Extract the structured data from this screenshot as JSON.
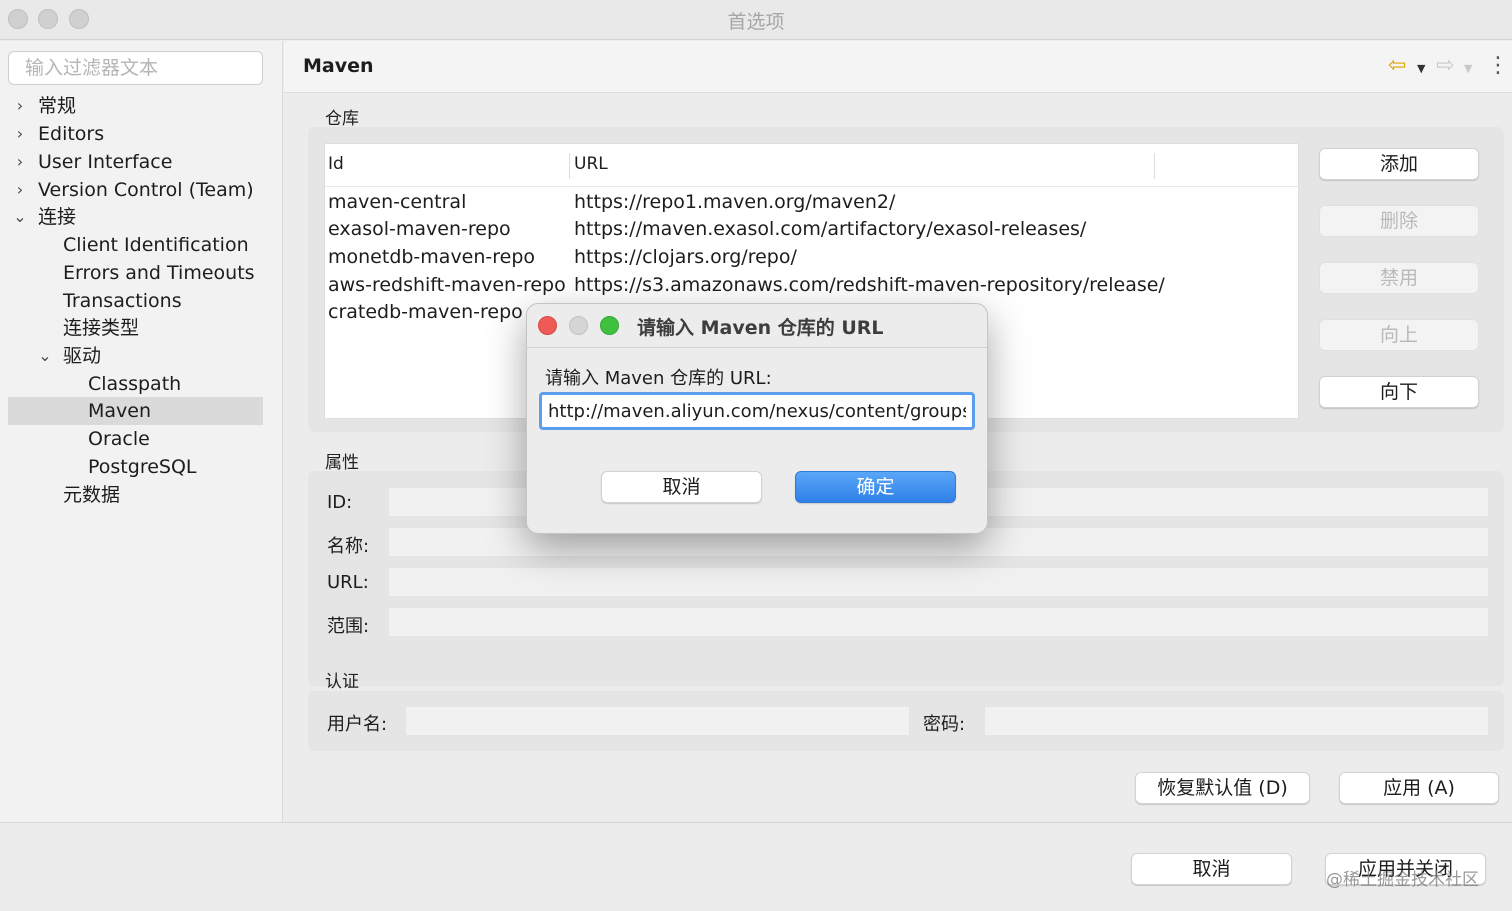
{
  "window": {
    "title": "首选项"
  },
  "sidebar": {
    "filter_placeholder": "输入过滤器文本",
    "items": [
      {
        "label": "常规"
      },
      {
        "label": "Editors"
      },
      {
        "label": "User Interface"
      },
      {
        "label": "Version Control (Team)"
      },
      {
        "label": "连接"
      },
      {
        "label": "Client Identification"
      },
      {
        "label": "Errors and Timeouts"
      },
      {
        "label": "Transactions"
      },
      {
        "label": "连接类型"
      },
      {
        "label": "驱动"
      },
      {
        "label": "Classpath"
      },
      {
        "label": "Maven"
      },
      {
        "label": "Oracle"
      },
      {
        "label": "PostgreSQL"
      },
      {
        "label": "元数据"
      }
    ]
  },
  "main": {
    "title": "Maven",
    "repo_section": {
      "label": "仓库",
      "columns": [
        "Id",
        "URL"
      ],
      "rows": [
        {
          "id": "maven-central",
          "url": "https://repo1.maven.org/maven2/"
        },
        {
          "id": "exasol-maven-repo",
          "url": "https://maven.exasol.com/artifactory/exasol-releases/"
        },
        {
          "id": "monetdb-maven-repo",
          "url": "https://clojars.org/repo/"
        },
        {
          "id": "aws-redshift-maven-repo",
          "url": "https://s3.amazonaws.com/redshift-maven-repository/release/"
        },
        {
          "id": "cratedb-maven-repo",
          "url": ""
        }
      ],
      "buttons": {
        "add": "添加",
        "delete": "删除",
        "disable": "禁用",
        "up": "向上",
        "down": "向下"
      }
    },
    "props_section": {
      "label": "属性",
      "fields": {
        "id": "ID:",
        "name": "名称:",
        "url": "URL:",
        "scope": "范围:"
      }
    },
    "auth_section": {
      "label": "认证",
      "username": "用户名:",
      "password": "密码:"
    },
    "restore_defaults": "恢复默认值 (D)",
    "apply": "应用 (A)"
  },
  "footer": {
    "cancel": "取消",
    "apply_close": "应用并关闭",
    "watermark": "@稀土掘金技术社区"
  },
  "dialog": {
    "title": "请输入 Maven 仓库的 URL",
    "prompt": "请输入 Maven 仓库的 URL:",
    "input_value": "http://maven.aliyun.com/nexus/content/groups/public/",
    "cancel": "取消",
    "ok": "确定"
  },
  "colors": {
    "accent": "#2f7fe8",
    "focus_ring": "#5d9ded",
    "close_light": "#ee5b57",
    "minimize_light": "#d6d6d6",
    "zoom_light": "#3fc13f"
  },
  "icons": [
    "back-arrow-icon",
    "forward-arrow-icon",
    "more-menu-icon",
    "chevron-right-icon",
    "chevron-down-icon"
  ]
}
